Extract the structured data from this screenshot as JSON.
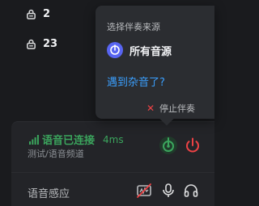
{
  "list": [
    {
      "icon": "lock-icon",
      "count": "2"
    },
    {
      "icon": "lock-icon",
      "count": "23"
    }
  ],
  "popup": {
    "title": "选择伴奏来源",
    "source_label": "所有音源",
    "noise_link": "遇到杂音了?",
    "stop_label": "停止伴奏"
  },
  "voice": {
    "status": "语音已连接",
    "ping": "4ms",
    "channel": "测试/语音频道",
    "vad_label": "语音感应"
  },
  "colors": {
    "connected": "#3ba55d",
    "danger": "#ed4245",
    "link": "#3ba0ff",
    "accent": "#5865f2"
  }
}
